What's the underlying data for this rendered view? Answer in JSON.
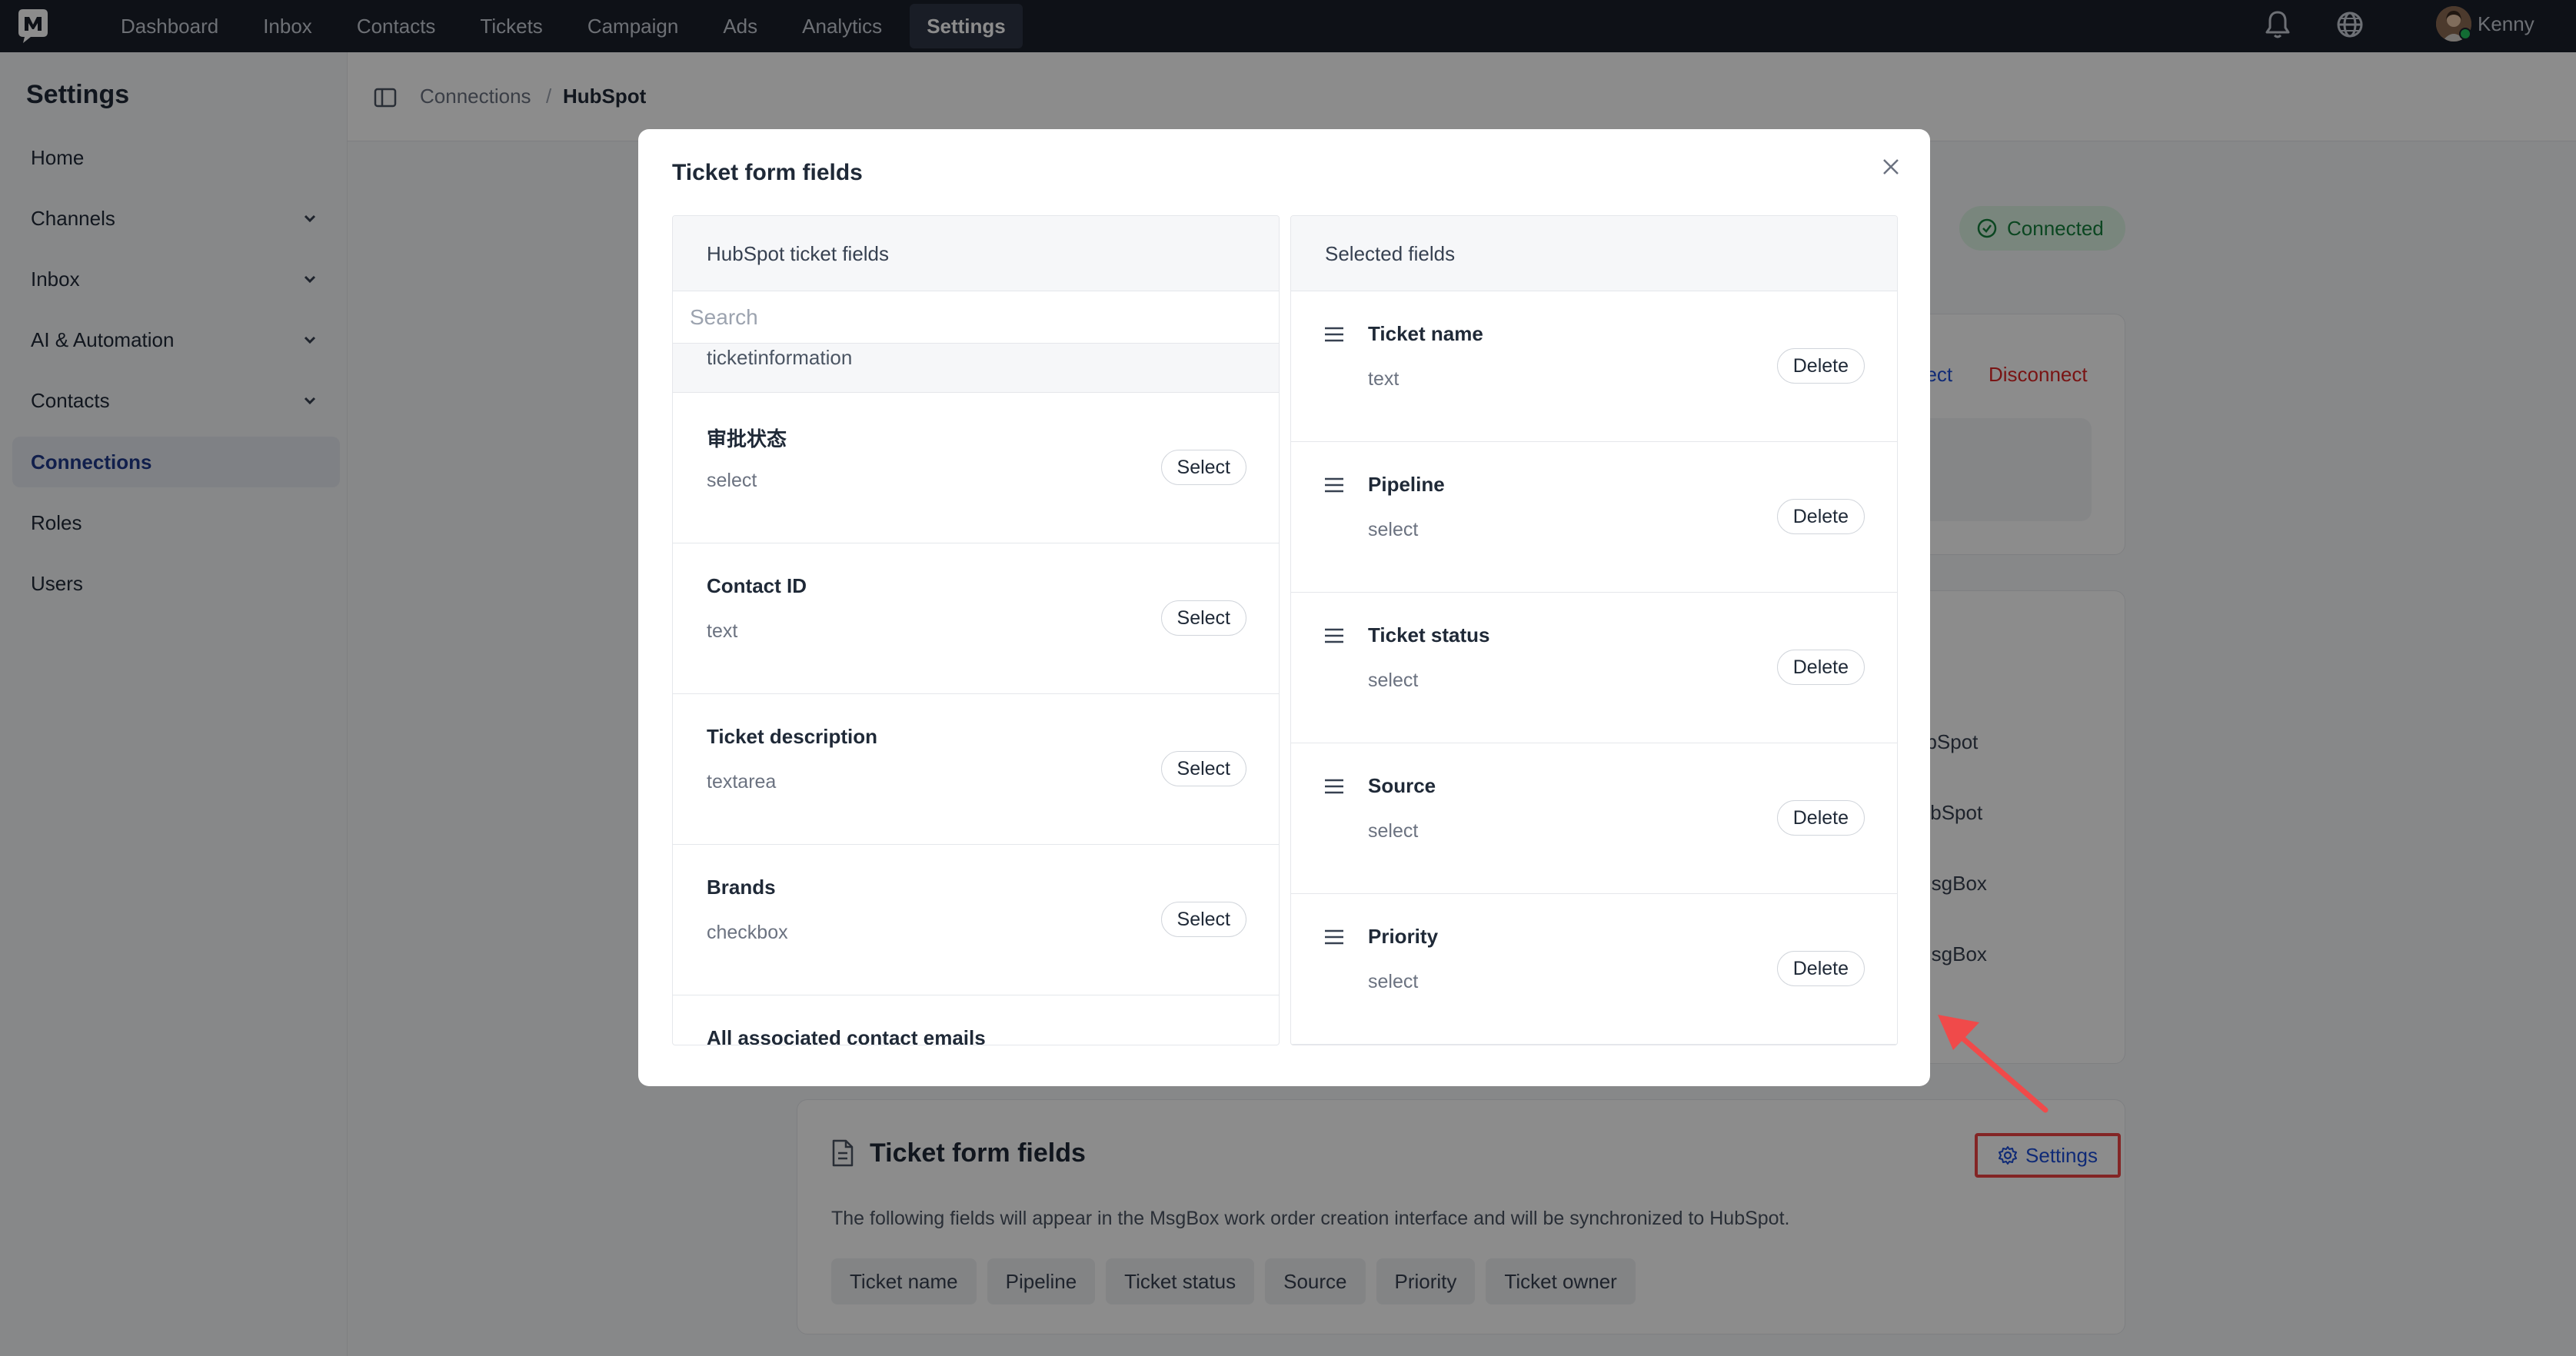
{
  "topnav": {
    "items": [
      {
        "label": "Dashboard",
        "active": false
      },
      {
        "label": "Inbox",
        "active": false
      },
      {
        "label": "Contacts",
        "active": false
      },
      {
        "label": "Tickets",
        "active": false
      },
      {
        "label": "Campaign",
        "active": false
      },
      {
        "label": "Ads",
        "active": false
      },
      {
        "label": "Analytics",
        "active": false
      },
      {
        "label": "Settings",
        "active": true
      }
    ],
    "user_name": "Kenny"
  },
  "sidebar": {
    "title": "Settings",
    "items": [
      {
        "label": "Home",
        "expandable": false,
        "active": false
      },
      {
        "label": "Channels",
        "expandable": true,
        "active": false
      },
      {
        "label": "Inbox",
        "expandable": true,
        "active": false
      },
      {
        "label": "AI & Automation",
        "expandable": true,
        "active": false
      },
      {
        "label": "Contacts",
        "expandable": true,
        "active": false
      },
      {
        "label": "Connections",
        "expandable": false,
        "active": true
      },
      {
        "label": "Roles",
        "expandable": false,
        "active": false
      },
      {
        "label": "Users",
        "expandable": false,
        "active": false
      }
    ]
  },
  "breadcrumb": {
    "parent": "Connections",
    "separator": "/",
    "current": "HubSpot"
  },
  "background": {
    "connected_label": "Connected",
    "reconnect_partial": "nect",
    "disconnect_label": "Disconnect",
    "partial_texts": [
      "ubSpot",
      "lubSpot",
      "MsgBox",
      "MsgBox"
    ],
    "ticket_form": {
      "title": "Ticket form fields",
      "description": "The following fields will appear in the MsgBox work order creation interface and will be synchronized to HubSpot.",
      "settings_label": "Settings",
      "chips": [
        "Ticket name",
        "Pipeline",
        "Ticket status",
        "Source",
        "Priority",
        "Ticket owner"
      ]
    }
  },
  "modal": {
    "title": "Ticket form fields",
    "left": {
      "header": "HubSpot ticket fields",
      "search_placeholder": "Search",
      "group": "ticketinformation",
      "select_label": "Select",
      "fields": [
        {
          "name": "审批状态",
          "type": "select"
        },
        {
          "name": "Contact ID",
          "type": "text"
        },
        {
          "name": "Ticket description",
          "type": "textarea"
        },
        {
          "name": "Brands",
          "type": "checkbox"
        }
      ],
      "partial_field": "All associated contact emails"
    },
    "right": {
      "header": "Selected fields",
      "delete_label": "Delete",
      "fields": [
        {
          "name": "Ticket name",
          "type": "text"
        },
        {
          "name": "Pipeline",
          "type": "select"
        },
        {
          "name": "Ticket status",
          "type": "select"
        },
        {
          "name": "Source",
          "type": "select"
        },
        {
          "name": "Priority",
          "type": "select"
        }
      ]
    }
  },
  "colors": {
    "accent": "#1f3a8a",
    "danger": "#dc2626",
    "success": "#15803d",
    "nav_bg": "#1a1f2b"
  }
}
